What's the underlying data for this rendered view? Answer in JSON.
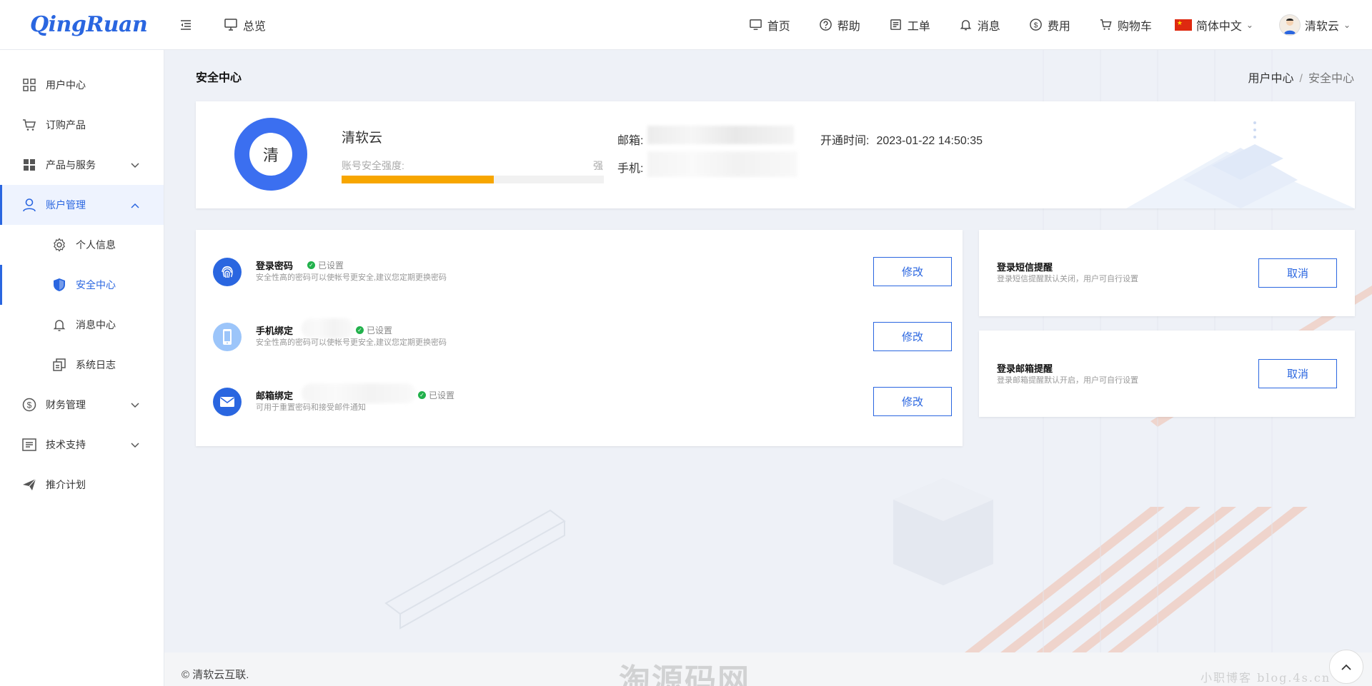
{
  "app": {
    "logo": "QingRuan"
  },
  "header": {
    "overview": "总览",
    "nav": [
      {
        "label": "首页",
        "icon": "home-monitor-icon"
      },
      {
        "label": "帮助",
        "icon": "help-icon"
      },
      {
        "label": "工单",
        "icon": "ticket-icon"
      },
      {
        "label": "消息",
        "icon": "bell-icon"
      },
      {
        "label": "费用",
        "icon": "dollar-icon"
      },
      {
        "label": "购物车",
        "icon": "cart-icon"
      }
    ],
    "language": "简体中文",
    "user": "清软云"
  },
  "sidebar": {
    "items": [
      {
        "label": "用户中心"
      },
      {
        "label": "订购产品"
      },
      {
        "label": "产品与服务"
      },
      {
        "label": "账户管理"
      },
      {
        "label": "个人信息"
      },
      {
        "label": "安全中心"
      },
      {
        "label": "消息中心"
      },
      {
        "label": "系统日志"
      },
      {
        "label": "财务管理"
      },
      {
        "label": "技术支持"
      },
      {
        "label": "推介计划"
      }
    ]
  },
  "page": {
    "title": "安全中心",
    "breadcrumb": [
      "用户中心",
      "/",
      "安全中心"
    ]
  },
  "profile": {
    "avatar_char": "清",
    "name": "清软云",
    "strength_label": "账号安全强度:",
    "strength_value": "强",
    "strength_ratio": 0.58,
    "email_label": "邮箱:",
    "phone_label": "手机:",
    "open_time_label": "开通时间:",
    "open_time": "2023-01-22 14:50:35"
  },
  "security": {
    "items": [
      {
        "title": "登录密码",
        "status": "已设置",
        "desc": "安全性高的密码可以使帐号更安全,建议您定期更换密码",
        "button": "修改"
      },
      {
        "title": "手机绑定",
        "status": "已设置",
        "desc": "安全性高的密码可以使帐号更安全,建议您定期更换密码",
        "button": "修改"
      },
      {
        "title": "邮箱绑定",
        "status": "已设置",
        "desc": "可用于重置密码和接受邮件通知",
        "button": "修改"
      }
    ]
  },
  "notices": [
    {
      "title": "登录短信提醒",
      "desc": "登录短信提醒默认关闭，用户可自行设置",
      "button": "取消"
    },
    {
      "title": "登录邮箱提醒",
      "desc": "登录邮箱提醒默认开启，用户可自行设置",
      "button": "取消"
    }
  ],
  "footer": {
    "copyright": "© 清软云互联.",
    "watermark": "淘源码网",
    "watermark2": "小职博客 blog.4s.cn"
  },
  "colors": {
    "primary": "#2a66e0",
    "strength": "#f7a600",
    "success": "#22b14c"
  }
}
